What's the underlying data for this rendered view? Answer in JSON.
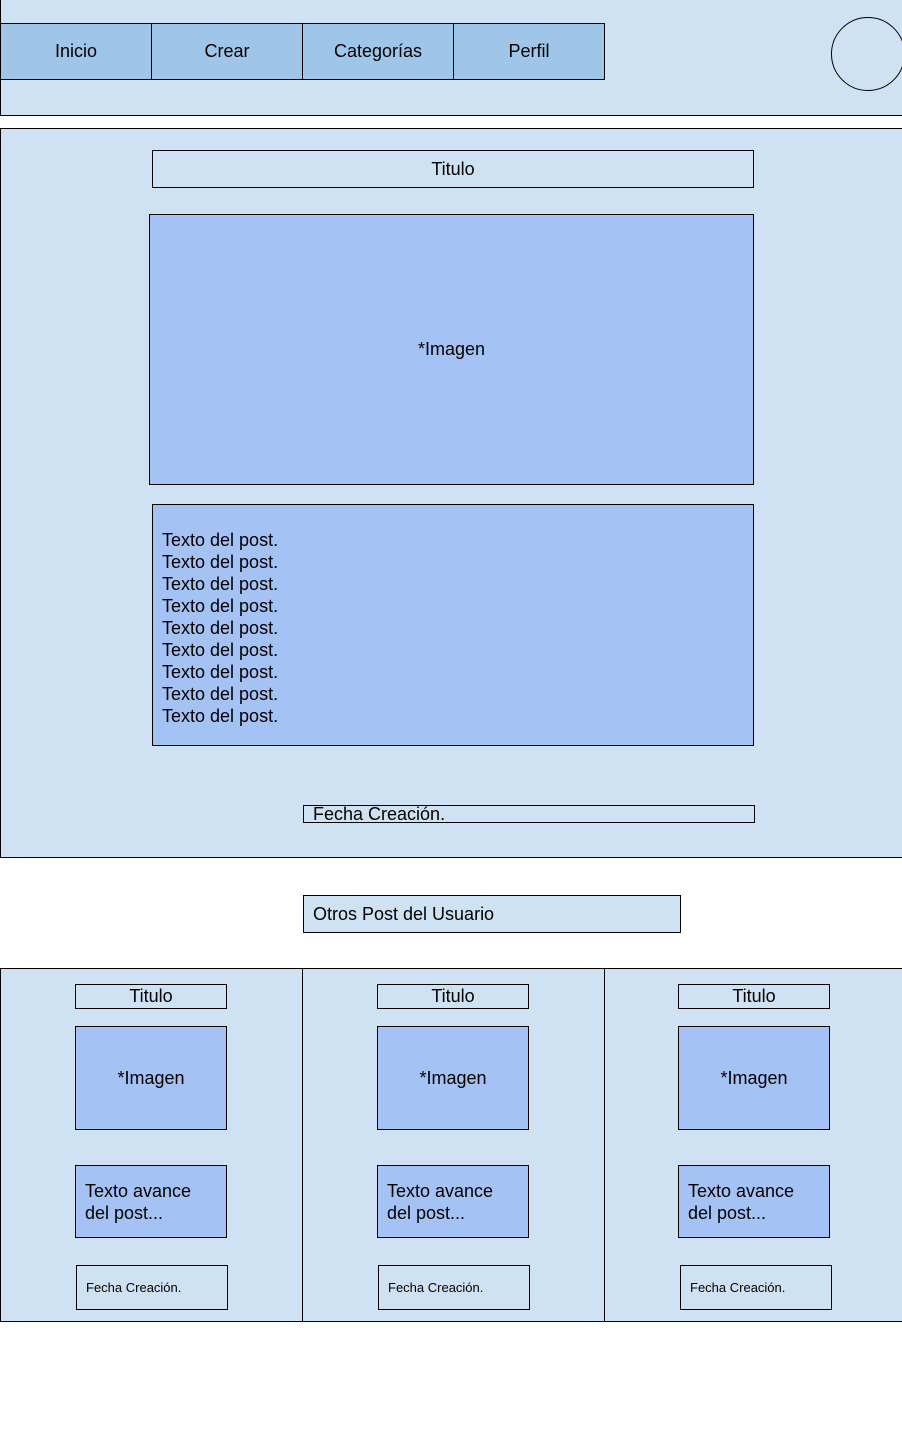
{
  "nav": {
    "items": [
      {
        "label": "Inicio"
      },
      {
        "label": "Crear"
      },
      {
        "label": "Categorías"
      },
      {
        "label": "Perfil"
      }
    ]
  },
  "post": {
    "title": "Titulo",
    "image_label": "*Imagen",
    "text_lines": [
      "Texto del post.",
      "Texto del post.",
      "Texto del post.",
      "Texto del post.",
      "Texto del post.",
      "Texto del post.",
      "Texto del post.",
      "Texto del post.",
      "Texto del post."
    ],
    "date_label": "Fecha Creación."
  },
  "other_posts": {
    "heading": "Otros Post del Usuario",
    "cards": [
      {
        "title": "Titulo",
        "image_label": "*Imagen",
        "text_line1": "Texto avance",
        "text_line2": "del post...",
        "date_label": "Fecha Creación."
      },
      {
        "title": "Titulo",
        "image_label": "*Imagen",
        "text_line1": "Texto avance",
        "text_line2": "del post...",
        "date_label": "Fecha Creación."
      },
      {
        "title": "Titulo",
        "image_label": "*Imagen",
        "text_line1": "Texto avance",
        "text_line2": "del post...",
        "date_label": "Fecha Creación."
      }
    ]
  },
  "colors": {
    "panel": "#cfe2f3",
    "nav_button": "#9fc5e8",
    "content_block": "#a4c2f4",
    "border": "#000000"
  }
}
